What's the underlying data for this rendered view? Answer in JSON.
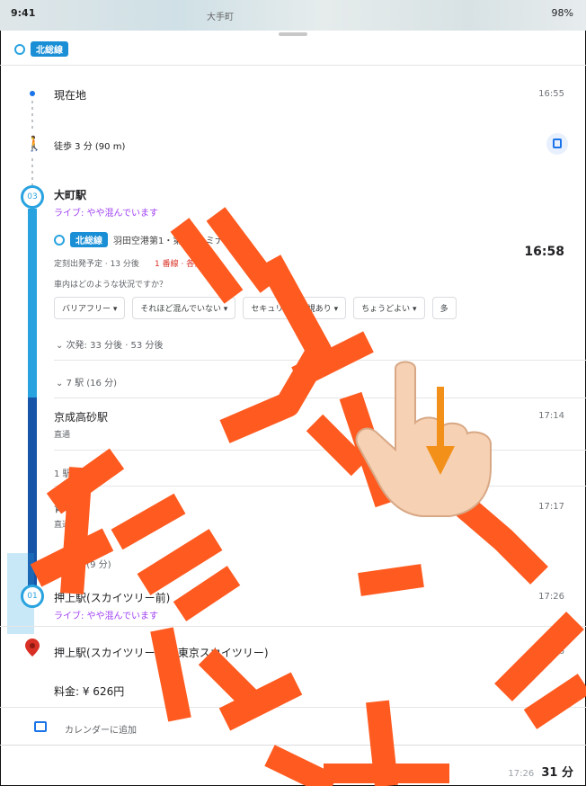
{
  "status": {
    "time": "9:41",
    "map_label": "大手町",
    "battery": "98%"
  },
  "line_badge": "北総線",
  "origin": {
    "label": "現在地",
    "time": "16:55"
  },
  "walk": {
    "label": "徒歩 3 分 (90 m)"
  },
  "station1": {
    "name": "大町駅",
    "crowd": "ライブ: やや混んでいます",
    "service_chip": "北総線",
    "service_dest": "羽田空港第1・第2ターミナル行",
    "depart_time": "16:58",
    "schedule_note": "定刻出発予定 · 13 分後",
    "schedule_kind": "1 番線 · 各停",
    "question": "車内はどのような状況ですか？",
    "tags": [
      "バリアフリー ▾",
      "それほど混んでいない ▾",
      "セキュリティ監視あり ▾",
      "ちょうどよい ▾",
      "多"
    ],
    "next_note": "次発: 33 分後 · 53 分後",
    "stops_note": "7 駅 (16 分)"
  },
  "stop_kyosei": {
    "name": "京成高砂駅",
    "sub": "直通",
    "time": "17:14"
  },
  "segment2": {
    "label": "1 駅 (3 分)"
  },
  "stop_aoto": {
    "name": "青砥駅",
    "sub": "直通",
    "time": "17:17"
  },
  "segment3": {
    "label": "6 駅 (9 分)"
  },
  "stop_oshiage": {
    "name": "押上駅(スカイツリー前)",
    "crowd": "ライブ: やや混んでいます",
    "time": "17:26"
  },
  "destination": {
    "name": "押上駅(スカイツリー前) (東京スカイツリー)",
    "time": "17:26"
  },
  "fare": "料金: ¥ 626円",
  "calendar": "カレンダーに追加",
  "footer": {
    "time": "17:26",
    "duration": "31 分"
  },
  "overlay": {
    "text_top": "テキスト",
    "text_bottom": "検出"
  },
  "colors": {
    "line_light": "#29a3e0",
    "line_dark": "#1655a8",
    "crowd": "#a142f4",
    "overlay": "#ff5a1f"
  }
}
